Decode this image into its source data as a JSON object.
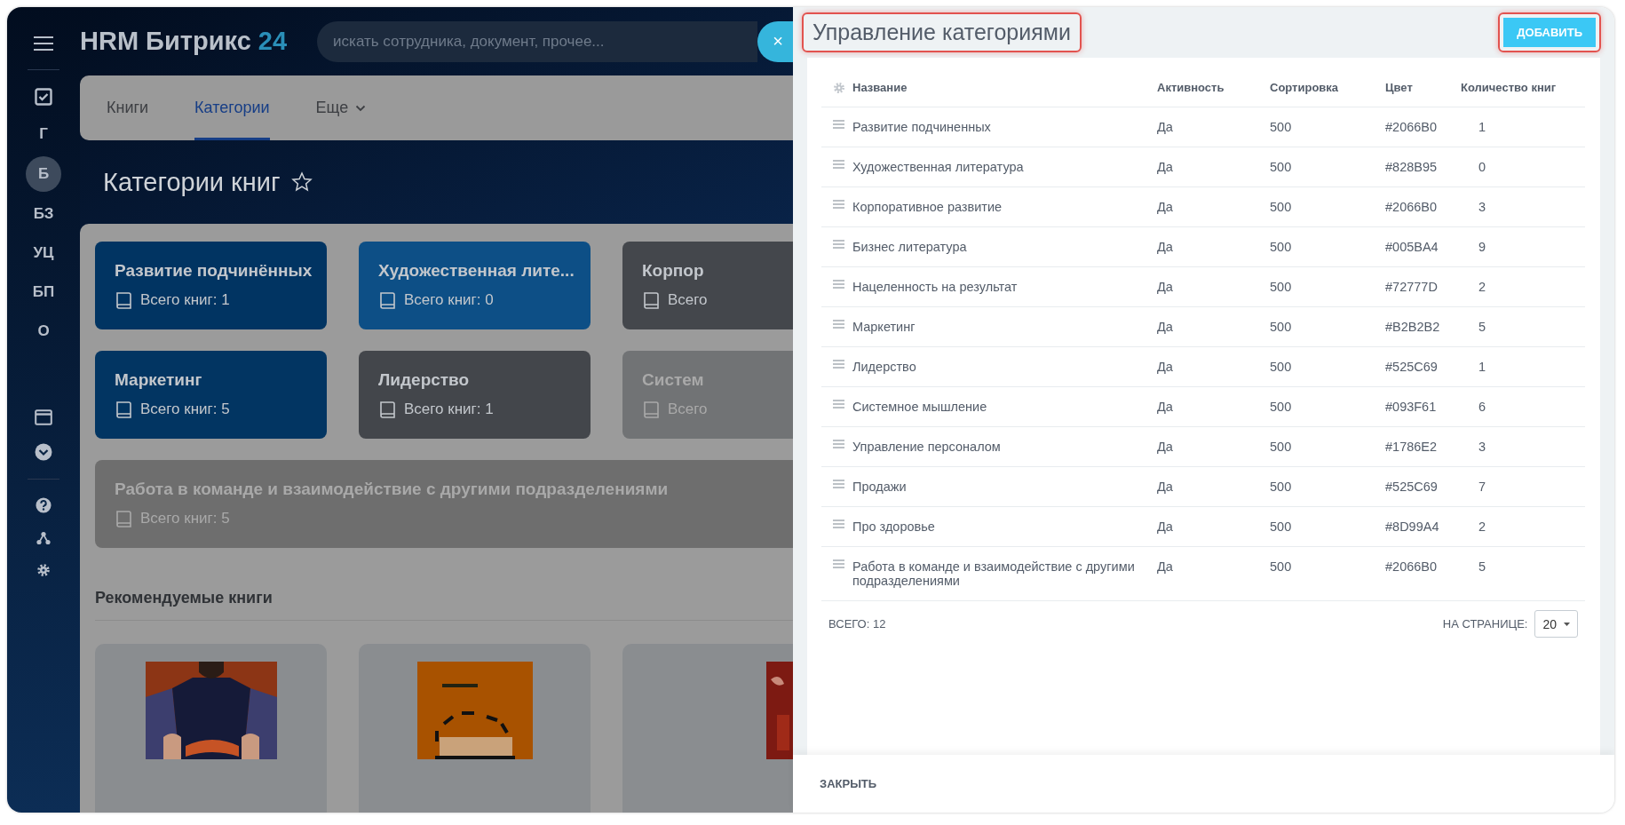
{
  "sidebar": {
    "letters": [
      {
        "label": "Г",
        "selected": false
      },
      {
        "label": "Б",
        "selected": true
      },
      {
        "label": "БЗ",
        "selected": false
      },
      {
        "label": "УЦ",
        "selected": false
      },
      {
        "label": "БП",
        "selected": false
      },
      {
        "label": "О",
        "selected": false
      }
    ]
  },
  "header": {
    "logo": "HRM Битрикс",
    "logo_number": "24",
    "search": {
      "placeholder": "искать сотрудника, документ, прочее..."
    },
    "clear_label": "×"
  },
  "tabs": [
    {
      "label": "Книги",
      "selected": false
    },
    {
      "label": "Категории",
      "selected": true
    },
    {
      "label": "Еще",
      "selected": false,
      "kind": "dropdown"
    }
  ],
  "page_title": "Категории книг",
  "cards": [
    {
      "title": "Развитие подчинённых",
      "count": "Всего книг:  1",
      "color": "#013462"
    },
    {
      "title": "Художественная лите...",
      "count": "Всего книг:  0",
      "color": "#0d4f86"
    },
    {
      "title": "Корпор",
      "count": "Всего",
      "color": "#44474c"
    },
    {
      "title": "Маркетинг",
      "count": "Всего книг:  5",
      "color": "#023562"
    },
    {
      "title": "Лидерство",
      "count": "Всего книг:  1",
      "color": "#43464b"
    },
    {
      "title": "Систем",
      "count": "Всего",
      "color": "#717375"
    },
    {
      "title": "Работа в команде и взаимодействие с другими подразделениями",
      "count": "Всего книг:  5",
      "color": "#6e6e6e",
      "kind": "wide"
    }
  ],
  "recommended": {
    "title": "Рекомендуемые книги"
  },
  "panel": {
    "title": "Управление категориями",
    "title_highlighted": true,
    "add_button": {
      "label": "ДОБАВИТЬ",
      "highlighted": true
    },
    "table": {
      "columns": [
        "Название",
        "Активность",
        "Сортировка",
        "Цвет",
        "Количество книг"
      ],
      "rows": [
        {
          "name": "Развитие подчиненных",
          "active": "Да",
          "sort": "500",
          "color_code": "#2066B0",
          "count": "1"
        },
        {
          "name": "Художественная литература",
          "active": "Да",
          "sort": "500",
          "color_code": "#828B95",
          "count": "0"
        },
        {
          "name": "Корпоративное развитие",
          "active": "Да",
          "sort": "500",
          "color_code": "#2066B0",
          "count": "3"
        },
        {
          "name": "Бизнес литература",
          "active": "Да",
          "sort": "500",
          "color_code": "#005BA4",
          "count": "9"
        },
        {
          "name": "Нацеленность на результат",
          "active": "Да",
          "sort": "500",
          "color_code": "#72777D",
          "count": "2"
        },
        {
          "name": "Маркетинг",
          "active": "Да",
          "sort": "500",
          "color_code": "#B2B2B2",
          "count": "5"
        },
        {
          "name": "Лидерство",
          "active": "Да",
          "sort": "500",
          "color_code": "#525C69",
          "count": "1"
        },
        {
          "name": "Системное мышление",
          "active": "Да",
          "sort": "500",
          "color_code": "#093F61",
          "count": "6"
        },
        {
          "name": "Управление персоналом",
          "active": "Да",
          "sort": "500",
          "color_code": "#1786E2",
          "count": "3"
        },
        {
          "name": "Продажи",
          "active": "Да",
          "sort": "500",
          "color_code": "#525C69",
          "count": "7"
        },
        {
          "name": "Про здоровье",
          "active": "Да",
          "sort": "500",
          "color_code": "#8D99A4",
          "count": "2"
        },
        {
          "name": "Работа в команде и взаимодействие с другими подразделениями",
          "active": "Да",
          "sort": "500",
          "color_code": "#2066B0",
          "count": "5"
        }
      ]
    },
    "total": "ВСЕГО: 12",
    "per_page_label": "НА СТРАНИЦЕ:",
    "per_page": "20",
    "close_button": "ЗАКРЫТЬ"
  }
}
